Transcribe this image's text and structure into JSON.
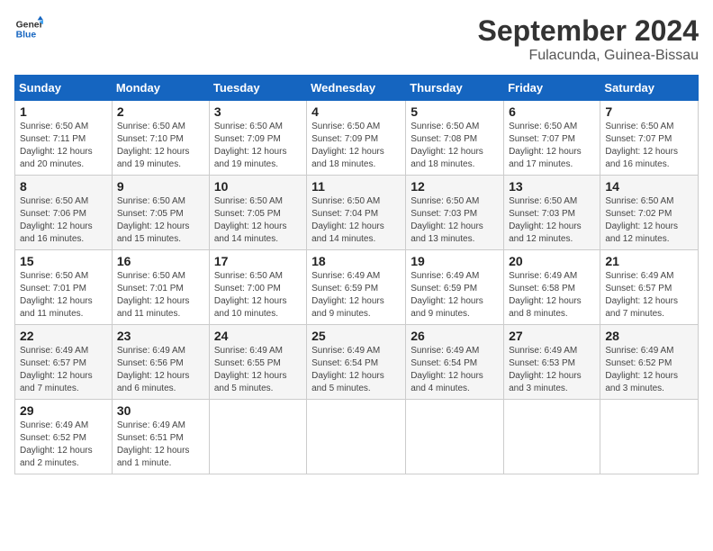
{
  "logo": {
    "text_general": "General",
    "text_blue": "Blue"
  },
  "title": "September 2024",
  "subtitle": "Fulacunda, Guinea-Bissau",
  "days_of_week": [
    "Sunday",
    "Monday",
    "Tuesday",
    "Wednesday",
    "Thursday",
    "Friday",
    "Saturday"
  ],
  "weeks": [
    [
      {
        "day": "1",
        "sunrise": "6:50 AM",
        "sunset": "7:11 PM",
        "daylight": "12 hours and 20 minutes."
      },
      {
        "day": "2",
        "sunrise": "6:50 AM",
        "sunset": "7:10 PM",
        "daylight": "12 hours and 19 minutes."
      },
      {
        "day": "3",
        "sunrise": "6:50 AM",
        "sunset": "7:09 PM",
        "daylight": "12 hours and 19 minutes."
      },
      {
        "day": "4",
        "sunrise": "6:50 AM",
        "sunset": "7:09 PM",
        "daylight": "12 hours and 18 minutes."
      },
      {
        "day": "5",
        "sunrise": "6:50 AM",
        "sunset": "7:08 PM",
        "daylight": "12 hours and 18 minutes."
      },
      {
        "day": "6",
        "sunrise": "6:50 AM",
        "sunset": "7:07 PM",
        "daylight": "12 hours and 17 minutes."
      },
      {
        "day": "7",
        "sunrise": "6:50 AM",
        "sunset": "7:07 PM",
        "daylight": "12 hours and 16 minutes."
      }
    ],
    [
      {
        "day": "8",
        "sunrise": "6:50 AM",
        "sunset": "7:06 PM",
        "daylight": "12 hours and 16 minutes."
      },
      {
        "day": "9",
        "sunrise": "6:50 AM",
        "sunset": "7:05 PM",
        "daylight": "12 hours and 15 minutes."
      },
      {
        "day": "10",
        "sunrise": "6:50 AM",
        "sunset": "7:05 PM",
        "daylight": "12 hours and 14 minutes."
      },
      {
        "day": "11",
        "sunrise": "6:50 AM",
        "sunset": "7:04 PM",
        "daylight": "12 hours and 14 minutes."
      },
      {
        "day": "12",
        "sunrise": "6:50 AM",
        "sunset": "7:03 PM",
        "daylight": "12 hours and 13 minutes."
      },
      {
        "day": "13",
        "sunrise": "6:50 AM",
        "sunset": "7:03 PM",
        "daylight": "12 hours and 12 minutes."
      },
      {
        "day": "14",
        "sunrise": "6:50 AM",
        "sunset": "7:02 PM",
        "daylight": "12 hours and 12 minutes."
      }
    ],
    [
      {
        "day": "15",
        "sunrise": "6:50 AM",
        "sunset": "7:01 PM",
        "daylight": "12 hours and 11 minutes."
      },
      {
        "day": "16",
        "sunrise": "6:50 AM",
        "sunset": "7:01 PM",
        "daylight": "12 hours and 11 minutes."
      },
      {
        "day": "17",
        "sunrise": "6:50 AM",
        "sunset": "7:00 PM",
        "daylight": "12 hours and 10 minutes."
      },
      {
        "day": "18",
        "sunrise": "6:49 AM",
        "sunset": "6:59 PM",
        "daylight": "12 hours and 9 minutes."
      },
      {
        "day": "19",
        "sunrise": "6:49 AM",
        "sunset": "6:59 PM",
        "daylight": "12 hours and 9 minutes."
      },
      {
        "day": "20",
        "sunrise": "6:49 AM",
        "sunset": "6:58 PM",
        "daylight": "12 hours and 8 minutes."
      },
      {
        "day": "21",
        "sunrise": "6:49 AM",
        "sunset": "6:57 PM",
        "daylight": "12 hours and 7 minutes."
      }
    ],
    [
      {
        "day": "22",
        "sunrise": "6:49 AM",
        "sunset": "6:57 PM",
        "daylight": "12 hours and 7 minutes."
      },
      {
        "day": "23",
        "sunrise": "6:49 AM",
        "sunset": "6:56 PM",
        "daylight": "12 hours and 6 minutes."
      },
      {
        "day": "24",
        "sunrise": "6:49 AM",
        "sunset": "6:55 PM",
        "daylight": "12 hours and 5 minutes."
      },
      {
        "day": "25",
        "sunrise": "6:49 AM",
        "sunset": "6:54 PM",
        "daylight": "12 hours and 5 minutes."
      },
      {
        "day": "26",
        "sunrise": "6:49 AM",
        "sunset": "6:54 PM",
        "daylight": "12 hours and 4 minutes."
      },
      {
        "day": "27",
        "sunrise": "6:49 AM",
        "sunset": "6:53 PM",
        "daylight": "12 hours and 3 minutes."
      },
      {
        "day": "28",
        "sunrise": "6:49 AM",
        "sunset": "6:52 PM",
        "daylight": "12 hours and 3 minutes."
      }
    ],
    [
      {
        "day": "29",
        "sunrise": "6:49 AM",
        "sunset": "6:52 PM",
        "daylight": "12 hours and 2 minutes."
      },
      {
        "day": "30",
        "sunrise": "6:49 AM",
        "sunset": "6:51 PM",
        "daylight": "12 hours and 1 minute."
      },
      null,
      null,
      null,
      null,
      null
    ]
  ],
  "labels": {
    "sunrise": "Sunrise:",
    "sunset": "Sunset:",
    "daylight": "Daylight:"
  }
}
